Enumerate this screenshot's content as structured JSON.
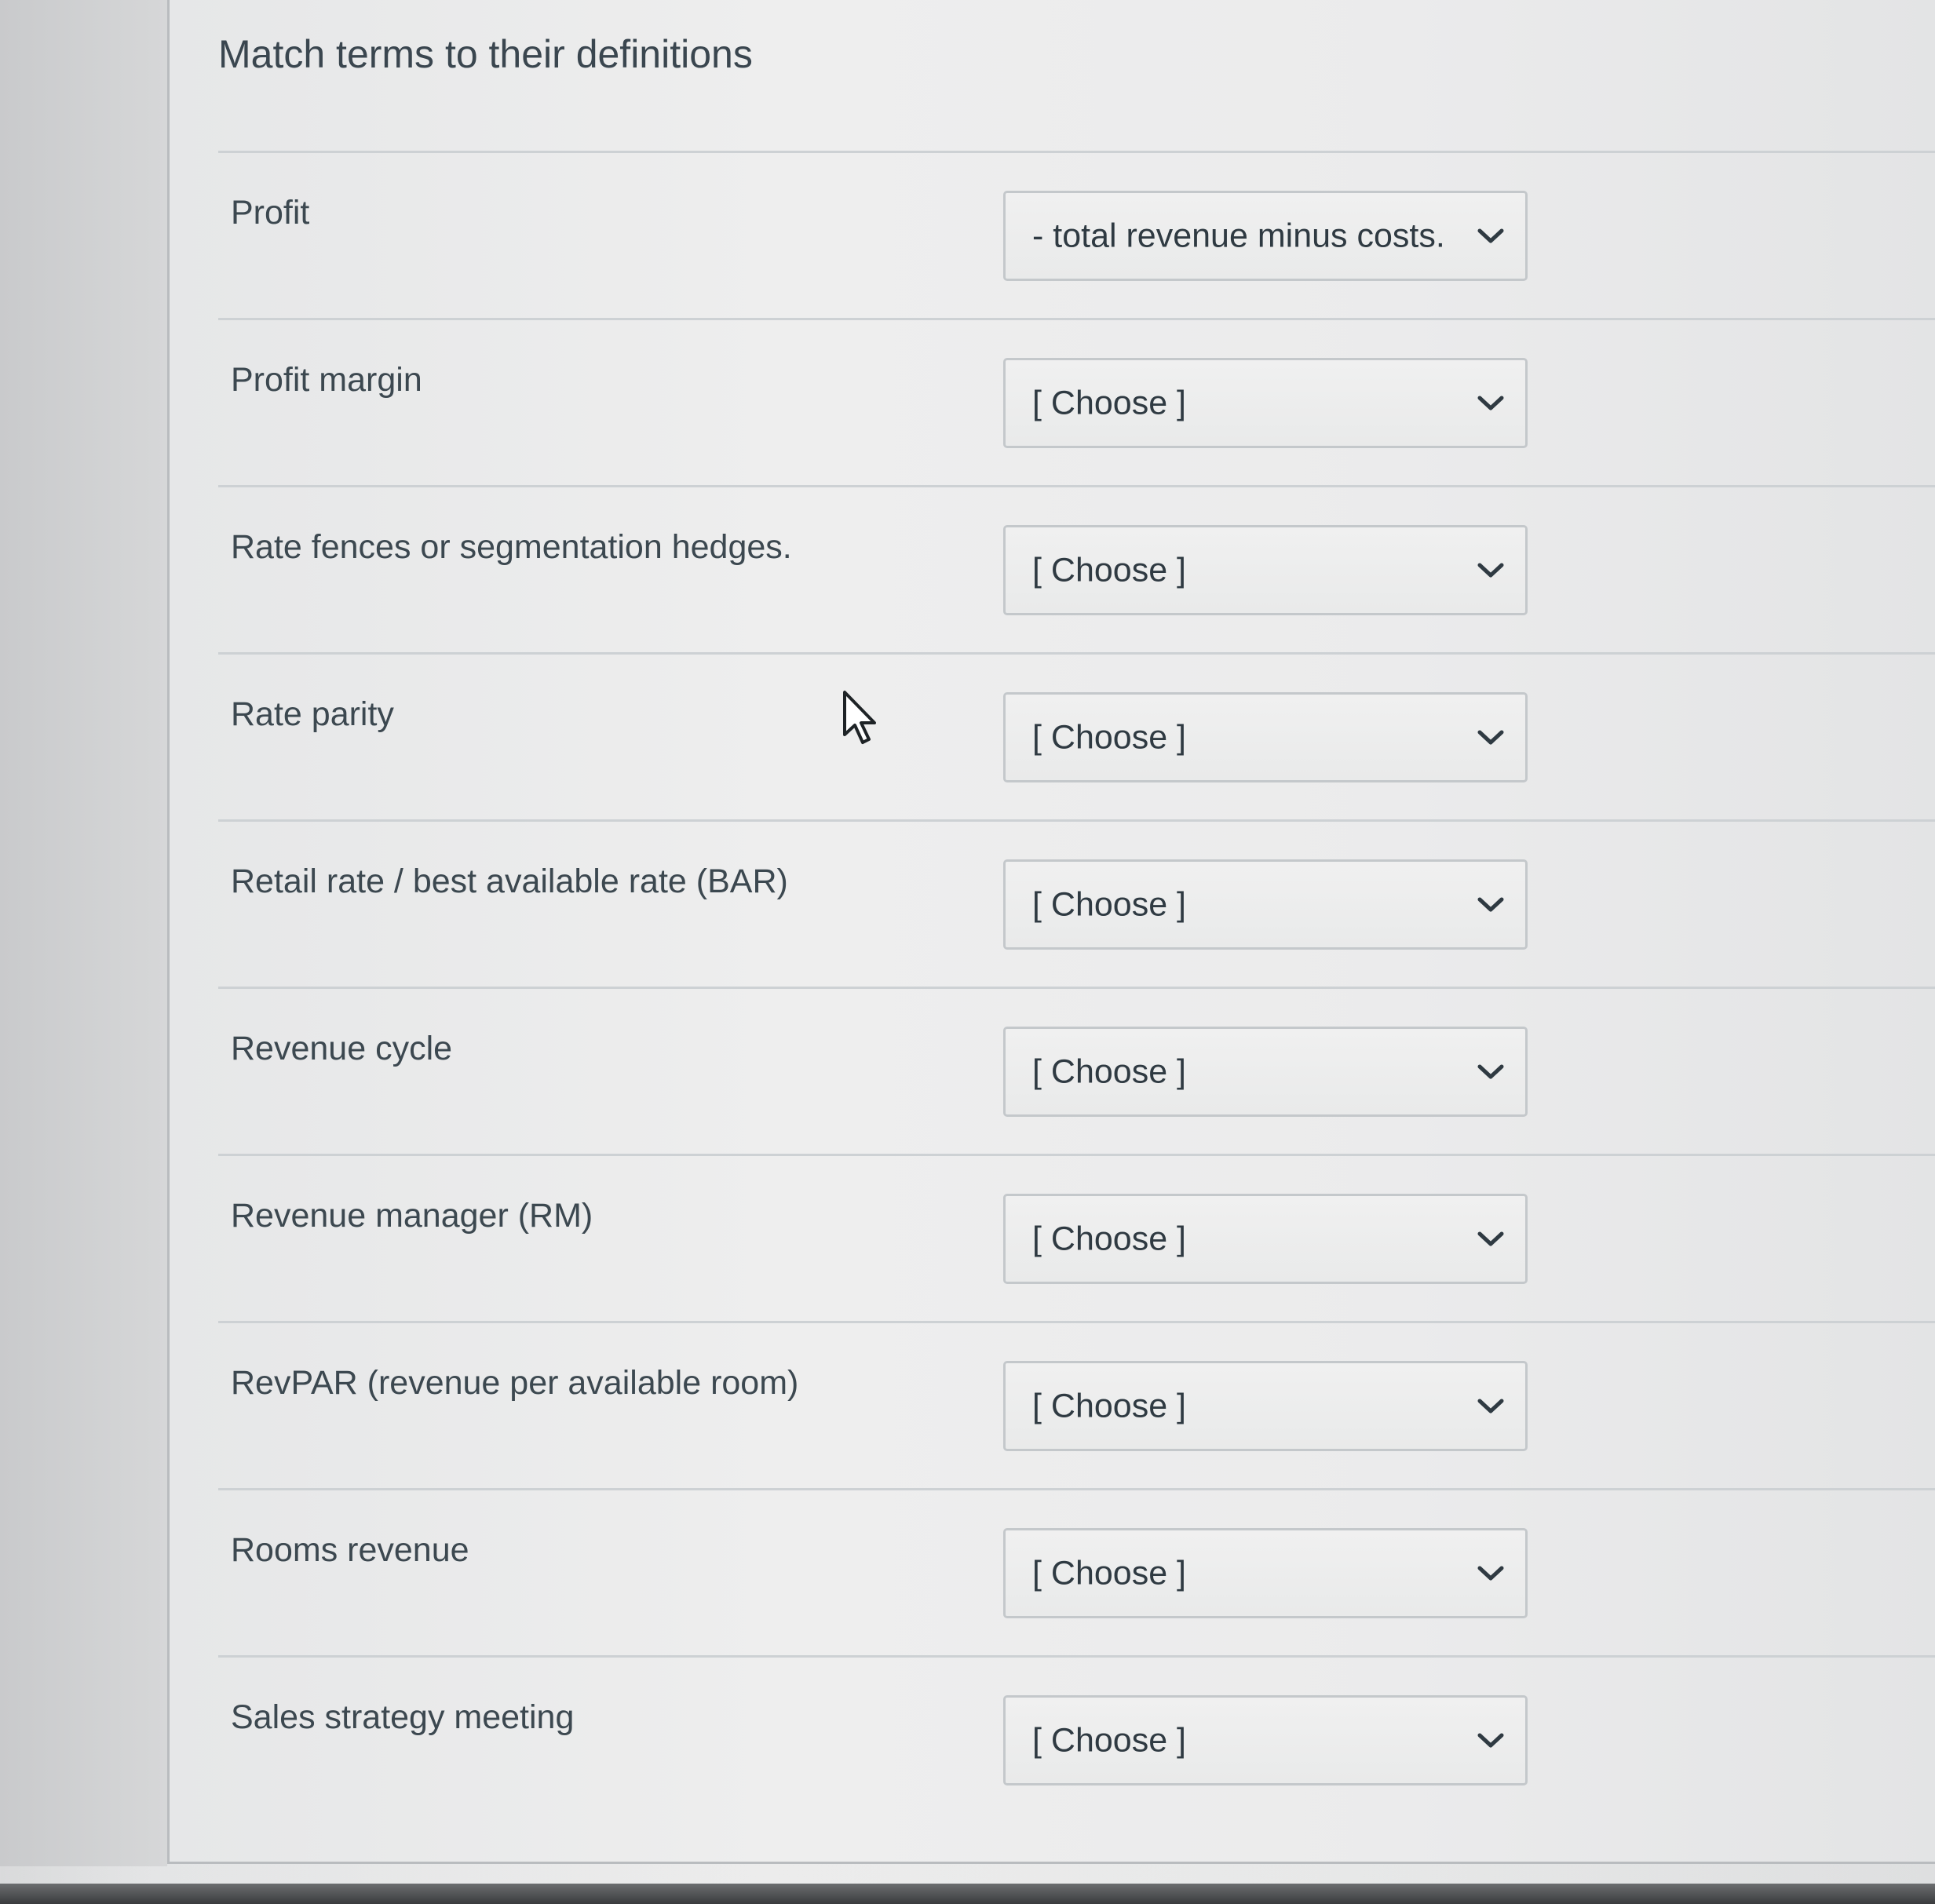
{
  "question": {
    "title": "Match terms to their definitions"
  },
  "rows": [
    {
      "term": "Profit",
      "selected": "- total revenue minus costs."
    },
    {
      "term": "Profit margin",
      "selected": "[ Choose ]"
    },
    {
      "term": "Rate fences or segmentation hedges.",
      "selected": "[ Choose ]"
    },
    {
      "term": "Rate parity",
      "selected": "[ Choose ]"
    },
    {
      "term": "Retail rate / best available rate (BAR)",
      "selected": "[ Choose ]"
    },
    {
      "term": "Revenue cycle",
      "selected": "[ Choose ]"
    },
    {
      "term": "Revenue manager (RM)",
      "selected": "[ Choose ]"
    },
    {
      "term": "RevPAR (revenue per available room)",
      "selected": "[ Choose ]"
    },
    {
      "term": "Rooms revenue",
      "selected": "[ Choose ]"
    },
    {
      "term": "Sales strategy meeting",
      "selected": "[ Choose ]"
    }
  ],
  "icons": {
    "dropdown": "chevron-down-icon",
    "pointer": "mouse-cursor-icon"
  },
  "colors": {
    "text": "#3c4850",
    "divider": "#cdd1d4",
    "select_border": "#c4c8cb"
  }
}
